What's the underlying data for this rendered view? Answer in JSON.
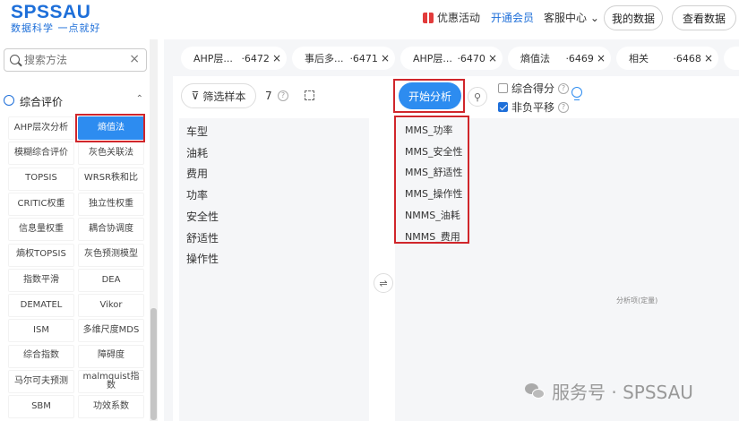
{
  "header": {
    "logo_main": "SPSSAU",
    "logo_sub": "数据科学 一点就好",
    "promo": "优惠活动",
    "member": "开通会员",
    "service": "客服中心",
    "service_chevron": "⌄",
    "my_data": "我的数据",
    "view_data": "查看数据"
  },
  "sidebar": {
    "search_placeholder": "搜索方法",
    "clear_glyph": "×",
    "section_title": "综合评价",
    "section_chevron": "⌃",
    "methods": [
      "AHP层次分析",
      "熵值法",
      "模糊综合评价",
      "灰色关联法",
      "TOPSIS",
      "WRSR秩和比",
      "CRITIC权重",
      "独立性权重",
      "信息量权重",
      "耦合协调度",
      "熵权TOPSIS",
      "灰色预测模型",
      "指数平滑",
      "DEA",
      "DEMATEL",
      "Vikor",
      "ISM",
      "多维尺度MDS",
      "综合指数",
      "障碍度",
      "马尔可夫预测",
      "malmquist指数",
      "SBM",
      "功效系数"
    ],
    "selected_method": "熵值法"
  },
  "tabs": [
    {
      "name": "AHP层...",
      "id": "·6472",
      "close": "×"
    },
    {
      "name": "事后多...",
      "id": "·6471",
      "close": "×"
    },
    {
      "name": "AHP层...",
      "id": "·6470",
      "close": "×"
    },
    {
      "name": "熵值法",
      "id": "·6469",
      "close": "×"
    },
    {
      "name": "相关",
      "id": "·6468",
      "close": "×"
    }
  ],
  "toolbar": {
    "filter_label": "筛选样本",
    "count": "7",
    "help_glyph": "?",
    "start_label": "开始分析",
    "opt_composite": "综合得分",
    "opt_nonneg": "非负平移",
    "opt_composite_checked": false,
    "opt_nonneg_checked": true
  },
  "variables": [
    "车型",
    "油耗",
    "费用",
    "功率",
    "安全性",
    "舒适性",
    "操作性"
  ],
  "analysis_items": [
    "MMS_功率",
    "MMS_安全性",
    "MMS_舒适性",
    "MMS_操作性",
    "NMMS_油耗",
    "NMMS_费用"
  ],
  "analysis_empty_label": "分析项(定量)",
  "swap_glyph": "⇌",
  "watermark": "服务号 · SPSSAU",
  "colors": {
    "accent": "#2d8cf0",
    "brand": "#1e6fd9",
    "highlight": "#d0262b"
  },
  "icons": [
    "gift-icon",
    "search-icon",
    "close-icon",
    "circle-icon",
    "chevron-up-icon",
    "filter-icon",
    "help-icon",
    "expand-icon",
    "swap-icon",
    "broom-icon",
    "lightbulb-icon",
    "wechat-icon"
  ]
}
